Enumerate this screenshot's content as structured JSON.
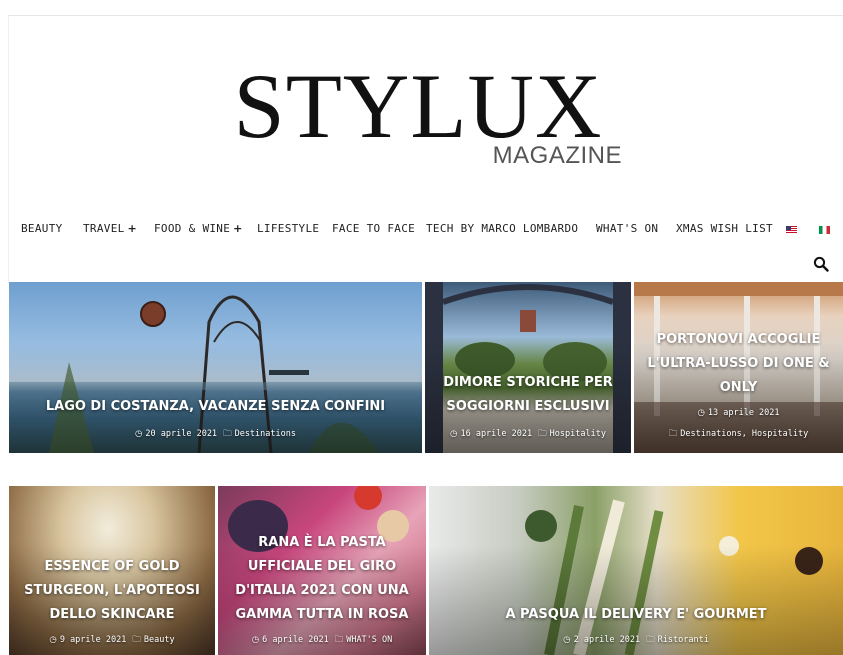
{
  "logo": {
    "title": "STYLUX",
    "subtitle": "MAGAZINE"
  },
  "nav": {
    "items": [
      {
        "label": "BEAUTY",
        "has_submenu": false
      },
      {
        "label": "TRAVEL",
        "has_submenu": true
      },
      {
        "label": "FOOD & WINE",
        "has_submenu": true
      },
      {
        "label": "LIFESTYLE",
        "has_submenu": false
      },
      {
        "label": "FACE TO FACE",
        "has_submenu": false
      },
      {
        "label": "TECH BY MARCO LOMBARDO",
        "has_submenu": false
      },
      {
        "label": "WHAT'S ON",
        "has_submenu": false
      },
      {
        "label": "XMAS WISH LIST",
        "has_submenu": false
      }
    ],
    "submenu_glyph": "+",
    "flags": [
      "us-flag-icon",
      "it-flag-icon"
    ],
    "search_icon": "search-icon"
  },
  "icons": {
    "clock": "◷",
    "folder": "🗀"
  },
  "cards": [
    {
      "title": "LAGO DI COSTANZA, VACANZE SENZA CONFINI",
      "date": "20 aprile 2021",
      "category": "Destinations"
    },
    {
      "title": "DIMORE STORICHE PER SOGGIORNI ESCLUSIVI",
      "date": "16 aprile 2021",
      "category": "Hospitality"
    },
    {
      "title": "PORTONOVI ACCOGLIE L'ULTRA-LUSSO DI ONE & ONLY",
      "date": "13 aprile 2021",
      "category": "Destinations, Hospitality"
    },
    {
      "title": "ESSENCE OF GOLD STURGEON, L'APOTEOSI DELLO SKINCARE",
      "date": "9 aprile 2021",
      "category": "Beauty"
    },
    {
      "title": "RANA È LA PASTA UFFICIALE DEL GIRO D'ITALIA 2021 CON UNA GAMMA TUTTA IN ROSA",
      "date": "6 aprile 2021",
      "category": "WHAT'S ON"
    },
    {
      "title": "A PASQUA IL DELIVERY E' GOURMET",
      "date": "2 aprile 2021",
      "category": "Ristoranti"
    }
  ],
  "colors": {
    "text": "#222222",
    "overlay_text": "#ffffff"
  }
}
